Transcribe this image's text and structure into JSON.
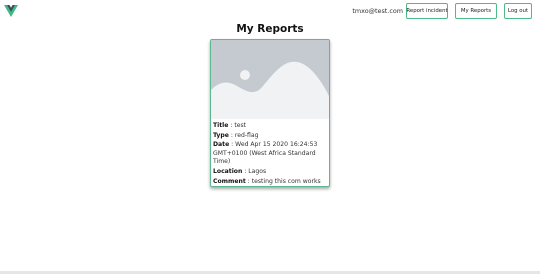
{
  "header": {
    "logo_icon": "vue-logo-icon",
    "user_email": "tmxo@test.com",
    "buttons": {
      "report_incident": "Report incident",
      "my_reports": "My Reports",
      "log_out": "Log out"
    }
  },
  "main": {
    "title": "My Reports",
    "reports": [
      {
        "image_icon": "image-placeholder-icon",
        "title_label": "Title",
        "title": "test",
        "type_label": "Type",
        "type": "red-flag",
        "date_label": "Date",
        "date": "Wed Apr 15 2020 16:24:53 GMT+0100 (West Africa Standard Time)",
        "location_label": "Location",
        "location": "Lagos",
        "comment_label": "Comment",
        "comment": "testing this com works"
      }
    ]
  },
  "colors": {
    "accent": "#4dba87",
    "logo_green": "#41b883",
    "logo_dark": "#35495e",
    "placeholder_bg": "#c5cad1",
    "placeholder_fg": "#f1f2f4"
  },
  "separator": " : "
}
